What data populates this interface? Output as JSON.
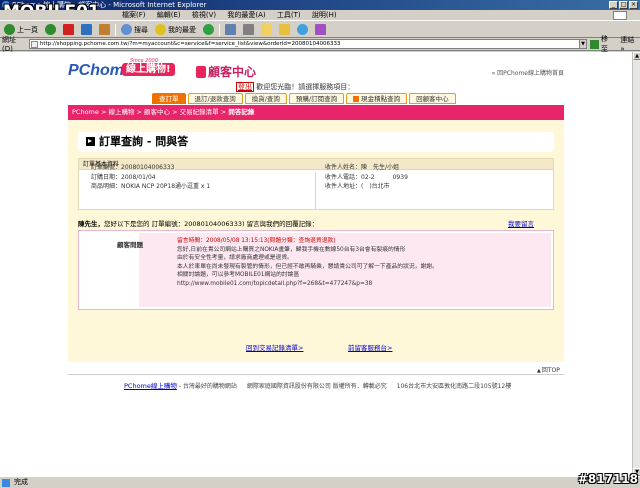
{
  "window": {
    "title": "PChome 線上購物 - 顧客中心 - Microsoft Internet Explorer",
    "watermark_top": "MOBILE01",
    "watermark_bottom": "#817118"
  },
  "menu": [
    "檔案(F)",
    "編輯(E)",
    "檢視(V)",
    "我的最愛(A)",
    "工具(T)",
    "說明(H)"
  ],
  "toolbar": {
    "back_label": "上一頁",
    "search_label": "搜尋",
    "favorites_label": "我的最愛"
  },
  "address": {
    "label": "網址(D)",
    "url": "http://shopping.pchome.com.tw/?m=myaccount&c=service&f=service_list&view&orderId=20080104006333",
    "go_label": "移至",
    "links_label": "連結 »"
  },
  "colors": {
    "brand_blue": "#2a58b8",
    "brand_pink": "#e8245a",
    "tab_active": "#f07000",
    "panel_bg": "#fff8d8"
  },
  "page": {
    "logo": "PChome",
    "logo_tag": "線上購物!",
    "logo_since": "Since 2000",
    "cs_title": "顧客中心",
    "back_home": "« 回PChome線上購物首頁",
    "userbar_logout": "登出",
    "userbar_text": "歡迎您光臨！請選擇服務項目：",
    "tabs": [
      {
        "label": "查訂單",
        "active": true
      },
      {
        "label": "退訂/退款查詢",
        "active": false
      },
      {
        "label": "換貨/查詢",
        "active": false
      },
      {
        "label": "預購/訂閱查詢",
        "active": false
      },
      {
        "label": "現金積點查詢",
        "active": false,
        "icon": true
      },
      {
        "label": "回顧客中心",
        "active": false
      }
    ],
    "breadcrumb": "PChome > 線上購物 > 顧客中心 > 交易紀錄清單 >",
    "breadcrumb_current": " 問答記錄",
    "panel_title": "訂單查詢 - 問與答",
    "info_title": "訂單基本資料",
    "info_left": [
      "訂單編號：20080104006333",
      "訂購日期：2008/01/04",
      "商品明細：NOKIA NCP 20P18通小逗重 x 1"
    ],
    "info_right": [
      "收件人姓名：陳　先生/小姐",
      "收件人電話：02-2　　　0939",
      "收件人地址：(　)台北市"
    ],
    "qa_prefix": "陳先生，",
    "qa_text": "您好以下是您的 訂單編號：20080104006333) 留言與我們的回覆記錄：",
    "qa_leave": "我要留言",
    "reply_label": "顧客問題",
    "reply_time": "留言時間：2008/05/08 13:15:13(問題分類：查詢退貨退款)",
    "reply_lines": [
      "您好,日前在貴公司網站上購買之NOKIA畫筆，歸我手機在數線50台有3台會有裂痕的情形",
      "由於有安全性考量，請求廠商處理或是退貨。",
      "本人於車單在尚未發現有裂管的情形，但已經不敢再騎乘，懇請貴公司可了解一下產品的狀況，謝謝。",
      "相關討論題，可以參考MOBILE01網站的討論區",
      "http://www.mobile01.com/topicdetail.php?f=268&t=477247&p=38"
    ],
    "bottom_link_1": "回到交易記錄清單>",
    "bottom_link_2": "前留客服務台>",
    "top_link": "回TOP",
    "footer_brand": "PChome線上購物",
    "footer_slogan": "- 台灣最好的購物網站",
    "footer_copy": "網際家庭國際資訊股份有限公司 版權所有．轉載必究",
    "footer_addr": "106台北市大安區敦化南路二段105號12樓"
  },
  "status": {
    "text": "完成"
  }
}
